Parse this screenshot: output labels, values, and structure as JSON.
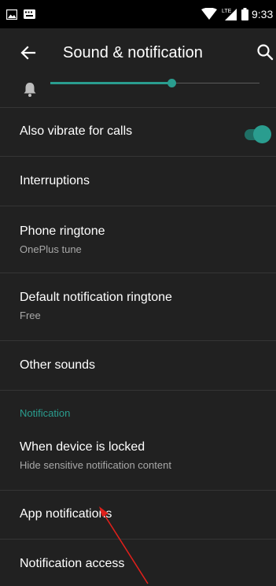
{
  "status_bar": {
    "time": "9:33",
    "network": "LTE",
    "left_icons": [
      "image-icon",
      "keyboard-icon"
    ],
    "right_icons": [
      "wifi-icon",
      "signal-icon",
      "battery-icon"
    ]
  },
  "app_bar": {
    "title": "Sound & notification",
    "back_icon": "arrow-left-icon",
    "search_icon": "search-icon"
  },
  "volume": {
    "icon": "bell-icon",
    "level": 0.58,
    "accent_color": "#2a9d8f"
  },
  "rows": {
    "also_vibrate": {
      "title": "Also vibrate for calls",
      "toggle_on": true
    },
    "interruptions": {
      "title": "Interruptions"
    },
    "phone_ringtone": {
      "title": "Phone ringtone",
      "subtitle": "OnePlus tune"
    },
    "default_notification": {
      "title": "Default notification ringtone",
      "subtitle": "Free"
    },
    "other_sounds": {
      "title": "Other sounds"
    },
    "device_locked": {
      "title": "When device is locked",
      "subtitle": "Hide sensitive notification content"
    },
    "app_notifications": {
      "title": "App notifications"
    },
    "notification_access": {
      "title": "Notification access"
    }
  },
  "section": {
    "notification_header": "Notification"
  },
  "colors": {
    "background": "#212121",
    "accent": "#2a9d8f",
    "annotation_arrow": "#e0201b"
  }
}
